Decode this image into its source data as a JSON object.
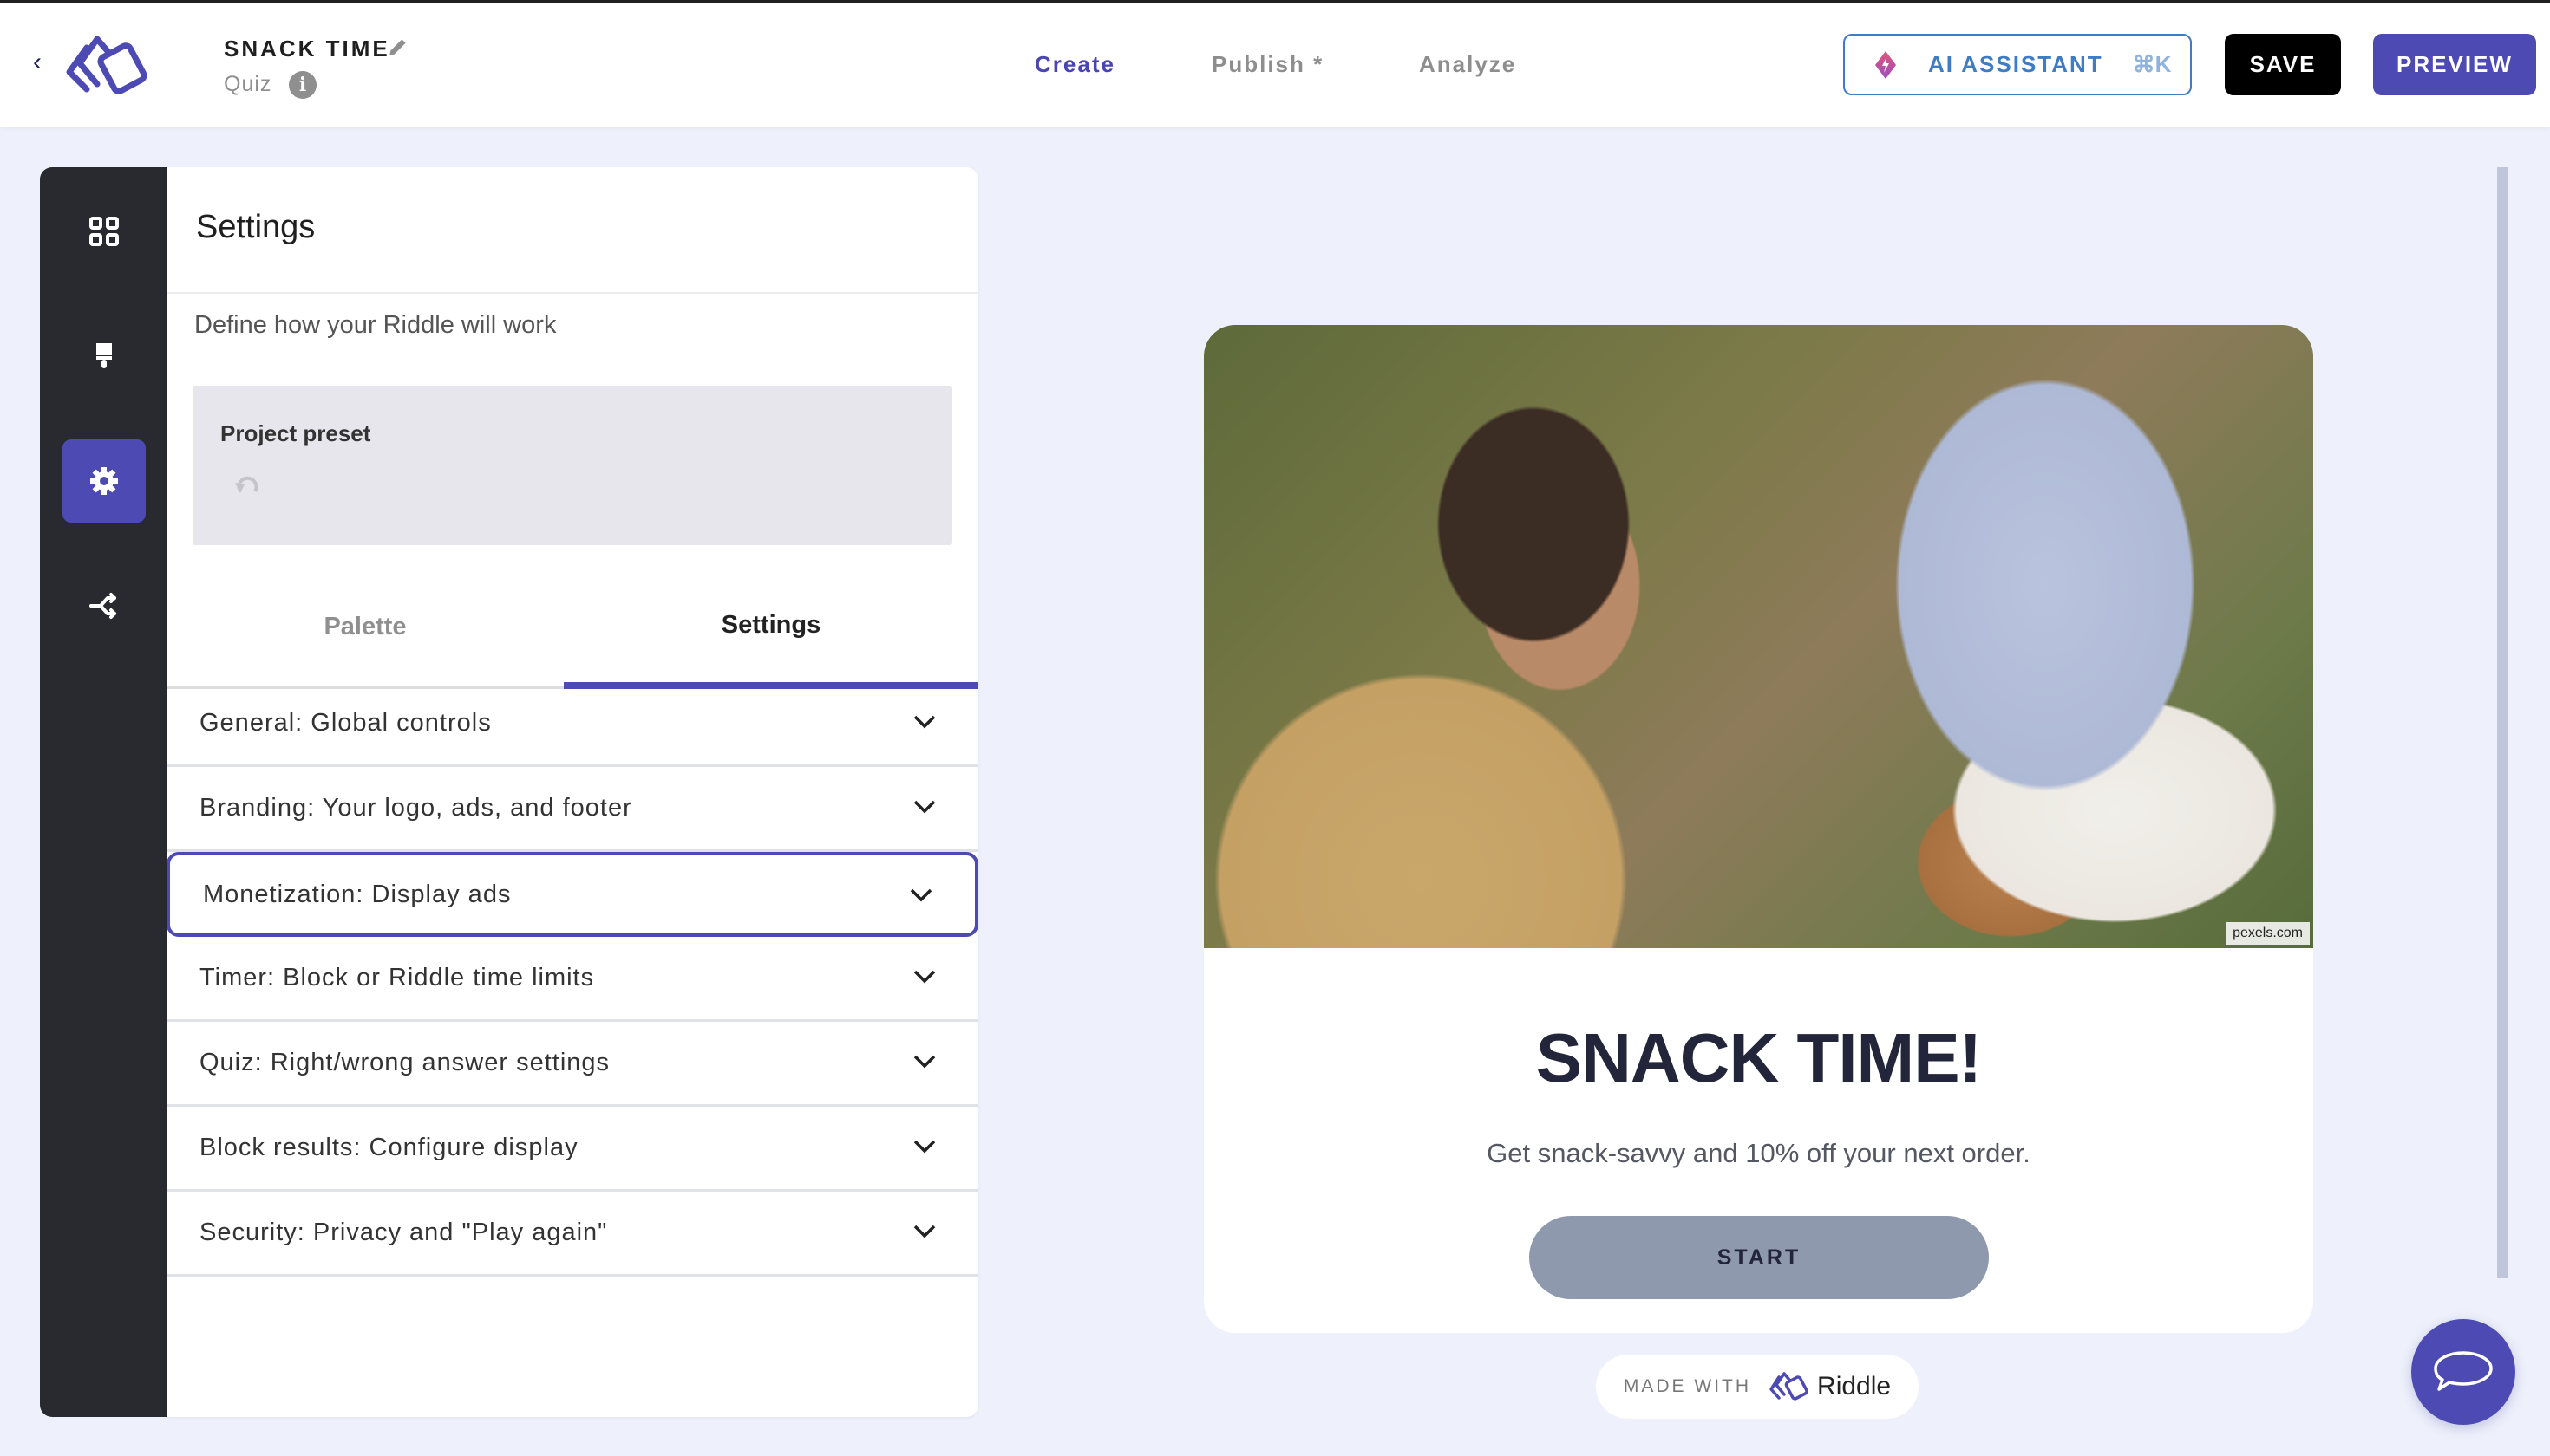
{
  "header": {
    "back_icon": "chevron-left-icon",
    "logo": "riddle-logo",
    "title": "SNACK TIME",
    "edit_icon": "pencil-icon",
    "subtitle": "Quiz",
    "info_glyph": "i",
    "nav": [
      {
        "label": "Create",
        "active": true
      },
      {
        "label": "Publish *",
        "active": false
      },
      {
        "label": "Analyze",
        "active": false
      }
    ],
    "ai_assistant": {
      "label": "AI ASSISTANT",
      "shortcut": "⌘K"
    },
    "save_label": "SAVE",
    "preview_label": "PREVIEW"
  },
  "sidebar": {
    "items": [
      {
        "icon": "grid-icon",
        "active": false
      },
      {
        "icon": "paintbrush-icon",
        "active": false
      },
      {
        "icon": "gear-icon",
        "active": true
      },
      {
        "icon": "share-branch-icon",
        "active": false
      }
    ]
  },
  "panel": {
    "title": "Settings",
    "description": "Define how your Riddle will work",
    "preset_label": "Project preset",
    "tabs": [
      {
        "label": "Palette",
        "active": false
      },
      {
        "label": "Settings",
        "active": true
      }
    ],
    "accordions": [
      {
        "label": "General: Global controls",
        "focused": false
      },
      {
        "label": "Branding: Your logo, ads, and footer",
        "focused": false
      },
      {
        "label": "Monetization: Display ads",
        "focused": true
      },
      {
        "label": "Timer: Block or Riddle time limits",
        "focused": false
      },
      {
        "label": "Quiz: Right/wrong answer settings",
        "focused": false
      },
      {
        "label": "Block results: Configure display",
        "focused": false
      },
      {
        "label": "Security: Privacy and \"Play again\"",
        "focused": false
      }
    ]
  },
  "preview": {
    "image_credit": "pexels.com",
    "title": "SNACK TIME!",
    "subtitle": "Get snack-savvy and 10% off your next order.",
    "start_label": "START",
    "made_with": "MADE WITH",
    "brand": "Riddle"
  },
  "colors": {
    "accent": "#4d4ab3",
    "ai_blue": "#3f7cc6",
    "sidebar_bg": "#282a30",
    "page_bg": "#eef1fb",
    "start_button": "#8f99ad"
  }
}
